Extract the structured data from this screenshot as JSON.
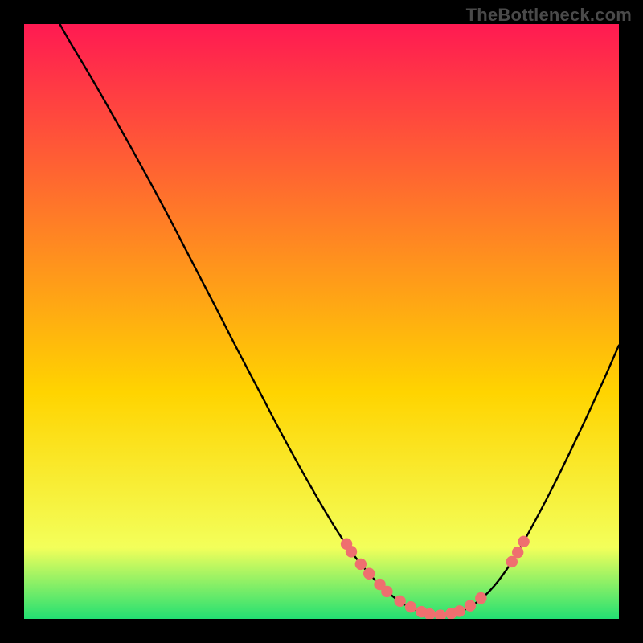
{
  "watermark": "TheBottleneck.com",
  "colors": {
    "gradient_top": "#ff1a52",
    "gradient_mid": "#ffd400",
    "gradient_bottom": "#23e072",
    "curve": "#000000",
    "dot": "#ef6f6f",
    "dot_edge": "#c94d4d"
  },
  "chart_data": {
    "type": "line",
    "title": "",
    "xlabel": "",
    "ylabel": "",
    "xlim": [
      0,
      100
    ],
    "ylim": [
      0,
      100
    ],
    "series": [
      {
        "name": "curve",
        "x": [
          6,
          8,
          11,
          14,
          17,
          20,
          24,
          28,
          32,
          36,
          40,
          44,
          48,
          52,
          55,
          58,
          61,
          64,
          67,
          70,
          73,
          76,
          79,
          82,
          85,
          89,
          93,
          97,
          100
        ],
        "y": [
          100,
          96.5,
          91.5,
          86.3,
          81,
          75.6,
          68.2,
          60.5,
          52.8,
          45,
          37.4,
          29.8,
          22.6,
          15.8,
          11.3,
          7.6,
          4.6,
          2.4,
          1.1,
          0.6,
          1.1,
          2.7,
          5.5,
          9.6,
          14.8,
          22.4,
          30.6,
          39.2,
          46.0
        ]
      }
    ],
    "dots": {
      "x": [
        54.2,
        55.0,
        56.6,
        58.0,
        59.8,
        61.0,
        63.2,
        65.0,
        66.8,
        68.2,
        70.0,
        71.8,
        73.2,
        75.0,
        76.8,
        82.0,
        83.0,
        84.0
      ],
      "y": [
        12.6,
        11.3,
        9.2,
        7.6,
        5.8,
        4.6,
        3.0,
        2.0,
        1.2,
        0.8,
        0.6,
        0.9,
        1.3,
        2.2,
        3.5,
        9.6,
        11.2,
        13.0
      ]
    }
  }
}
